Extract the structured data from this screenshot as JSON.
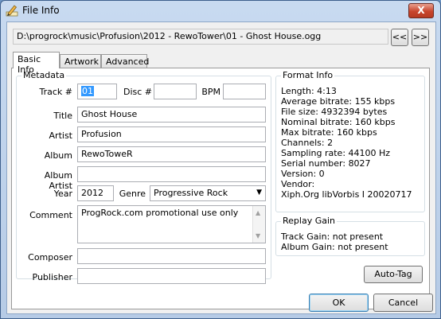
{
  "window": {
    "title": "File Info",
    "close_label": "X"
  },
  "path": {
    "value": "D:\\progrock\\music\\Profusion\\2012 - RewoTower\\01 - Ghost House.ogg"
  },
  "nav": {
    "prev_label": "<<",
    "next_label": ">>"
  },
  "tabs": [
    {
      "label": "Basic Info",
      "active": true
    },
    {
      "label": "Artwork",
      "active": false
    },
    {
      "label": "Advanced",
      "active": false
    }
  ],
  "metadata": {
    "group_title": "Metadata",
    "track_label": "Track #",
    "track_value": "01",
    "disc_label": "Disc #",
    "disc_value": "",
    "bpm_label": "BPM",
    "bpm_value": "",
    "title_label": "Title",
    "title_value": "Ghost House",
    "artist_label": "Artist",
    "artist_value": "Profusion",
    "album_label": "Album",
    "album_value": "RewoToweR",
    "album_artist_label": "Album Artist",
    "album_artist_value": "",
    "year_label": "Year",
    "year_value": "2012",
    "genre_label": "Genre",
    "genre_value": "Progressive Rock",
    "comment_label": "Comment",
    "comment_value": "ProgRock.com promotional use only",
    "composer_label": "Composer",
    "composer_value": "",
    "publisher_label": "Publisher",
    "publisher_value": ""
  },
  "format_info": {
    "group_title": "Format Info",
    "lines": [
      "Length: 4:13",
      "Average bitrate: 155 kbps",
      "File size: 4932394 bytes",
      "Nominal bitrate: 160 kbps",
      "Max bitrate: 160 kbps",
      "Channels: 2",
      "Sampling rate: 44100 Hz",
      "Serial number: 8027",
      "Version: 0",
      "Vendor:",
      "Xiph.Org libVorbis I 20020717"
    ]
  },
  "replay_gain": {
    "group_title": "Replay Gain",
    "lines": [
      "Track Gain: not present",
      "Album Gain: not present"
    ]
  },
  "buttons": {
    "auto_tag": "Auto-Tag",
    "ok": "OK",
    "cancel": "Cancel"
  }
}
